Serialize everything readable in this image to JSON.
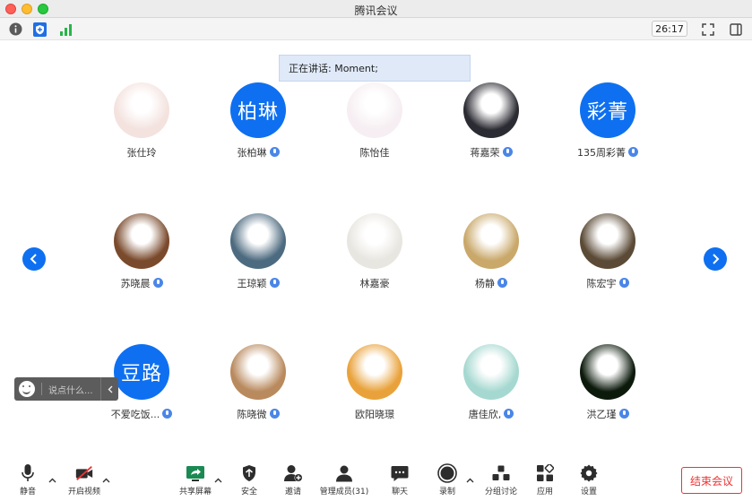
{
  "window": {
    "title": "腾讯会议"
  },
  "topbar": {
    "timer": "26:17"
  },
  "speaking_banner": "正在讲话: Moment;",
  "participants": [
    {
      "name": "张仕玲",
      "avatar_text": "",
      "avatar_color": "#f3e2de",
      "mic": false
    },
    {
      "name": "张柏琳",
      "avatar_text": "柏琳",
      "avatar_color": "#0e70f0",
      "mic": true
    },
    {
      "name": "陈怡佳",
      "avatar_text": "",
      "avatar_color": "#f6eef2",
      "mic": false
    },
    {
      "name": "蒋嘉荣",
      "avatar_text": "",
      "avatar_color": "#2b2b33",
      "mic": true
    },
    {
      "name": "135周彩菁",
      "avatar_text": "彩菁",
      "avatar_color": "#0e70f0",
      "mic": true
    },
    {
      "name": "苏晓晨",
      "avatar_text": "",
      "avatar_color": "#7a4a2c",
      "mic": true
    },
    {
      "name": "王琼颖",
      "avatar_text": "",
      "avatar_color": "#4d6b80",
      "mic": true
    },
    {
      "name": "林嘉豪",
      "avatar_text": "",
      "avatar_color": "#e8e6e0",
      "mic": false
    },
    {
      "name": "杨静",
      "avatar_text": "",
      "avatar_color": "#c9a86a",
      "mic": true
    },
    {
      "name": "陈宏宇",
      "avatar_text": "",
      "avatar_color": "#5b4a36",
      "mic": true
    },
    {
      "name": "不爱吃饭...",
      "avatar_text": "豆路",
      "avatar_color": "#0e70f0",
      "mic": true
    },
    {
      "name": "陈晓微",
      "avatar_text": "",
      "avatar_color": "#b98a5e",
      "mic": true
    },
    {
      "name": "欧阳晓璟",
      "avatar_text": "",
      "avatar_color": "#e9a23b",
      "mic": false
    },
    {
      "name": "唐佳欣,",
      "avatar_text": "",
      "avatar_color": "#a5d8d0",
      "mic": true
    },
    {
      "name": "洪乙瑾",
      "avatar_text": "",
      "avatar_color": "#0c1a0c",
      "mic": true
    }
  ],
  "chat": {
    "placeholder": "说点什么..."
  },
  "toolbar": {
    "mute": "静音",
    "video": "开启视频",
    "share": "共享屏幕",
    "security": "安全",
    "invite": "邀请",
    "members": "管理成员(31)",
    "chat": "聊天",
    "record": "录制",
    "breakout": "分组讨论",
    "apps": "应用",
    "settings": "设置",
    "end": "结束会议"
  },
  "colors": {
    "accent": "#0e70f0",
    "end": "#ee3333"
  }
}
